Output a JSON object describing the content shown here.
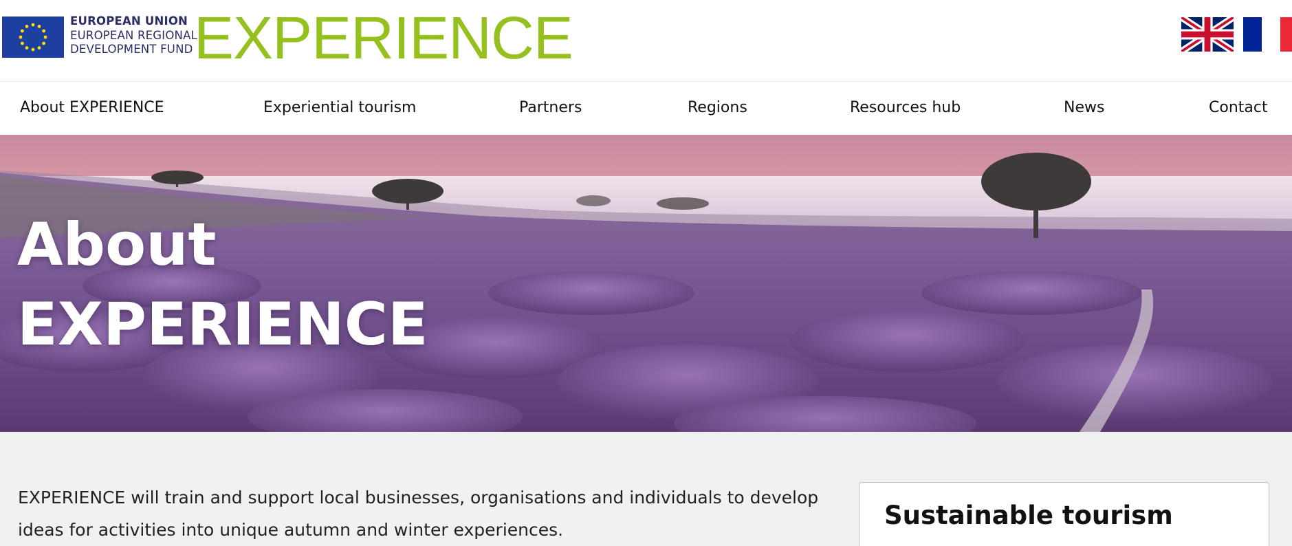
{
  "header": {
    "eu_lines": [
      "EUROPEAN UNION",
      "EUROPEAN REGIONAL",
      "DEVELOPMENT FUND"
    ],
    "brand": "EXPERIENCE",
    "brand_color": "#95c11f",
    "eu_flag_icon": "eu-flag-icon",
    "languages": [
      {
        "code": "en",
        "icon": "uk-flag-icon"
      },
      {
        "code": "fr",
        "icon": "france-flag-icon"
      }
    ]
  },
  "nav": {
    "items": [
      {
        "label": "About EXPERIENCE"
      },
      {
        "label": "Experiential tourism"
      },
      {
        "label": "Partners"
      },
      {
        "label": "Regions"
      },
      {
        "label": "Resources hub"
      },
      {
        "label": "News"
      },
      {
        "label": "Contact"
      }
    ]
  },
  "hero": {
    "title_line1": "About",
    "title_line2": "EXPERIENCE"
  },
  "content": {
    "intro_line1": "EXPERIENCE will train and support local businesses, organisations and individuals to develop",
    "intro_line2": "ideas for activities into unique autumn and winter experiences.",
    "sidebar_title": "Sustainable tourism"
  }
}
